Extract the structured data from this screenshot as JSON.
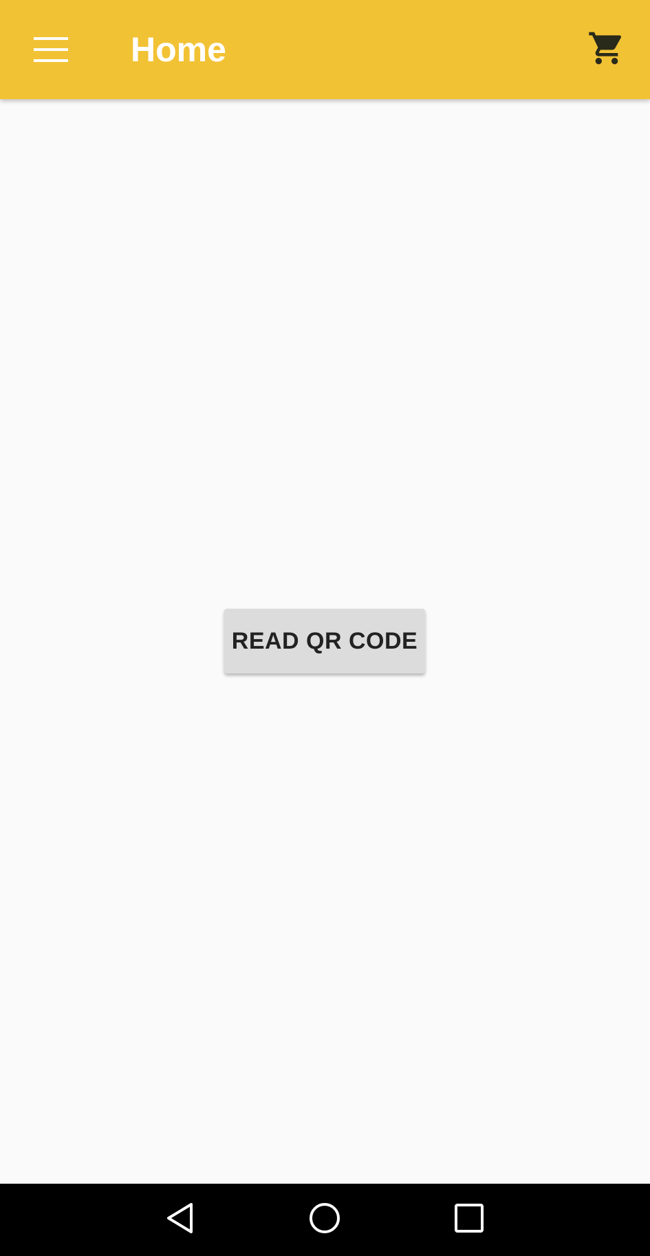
{
  "app_bar": {
    "title": "Home",
    "menu_icon": "hamburger-menu-icon",
    "cart_icon": "shopping-cart-icon",
    "background_color": "#f2c235"
  },
  "main": {
    "read_qr_button_label": "READ QR CODE"
  },
  "nav_bar": {
    "back_icon": "back-triangle-icon",
    "home_icon": "home-circle-icon",
    "recents_icon": "recents-square-icon"
  }
}
